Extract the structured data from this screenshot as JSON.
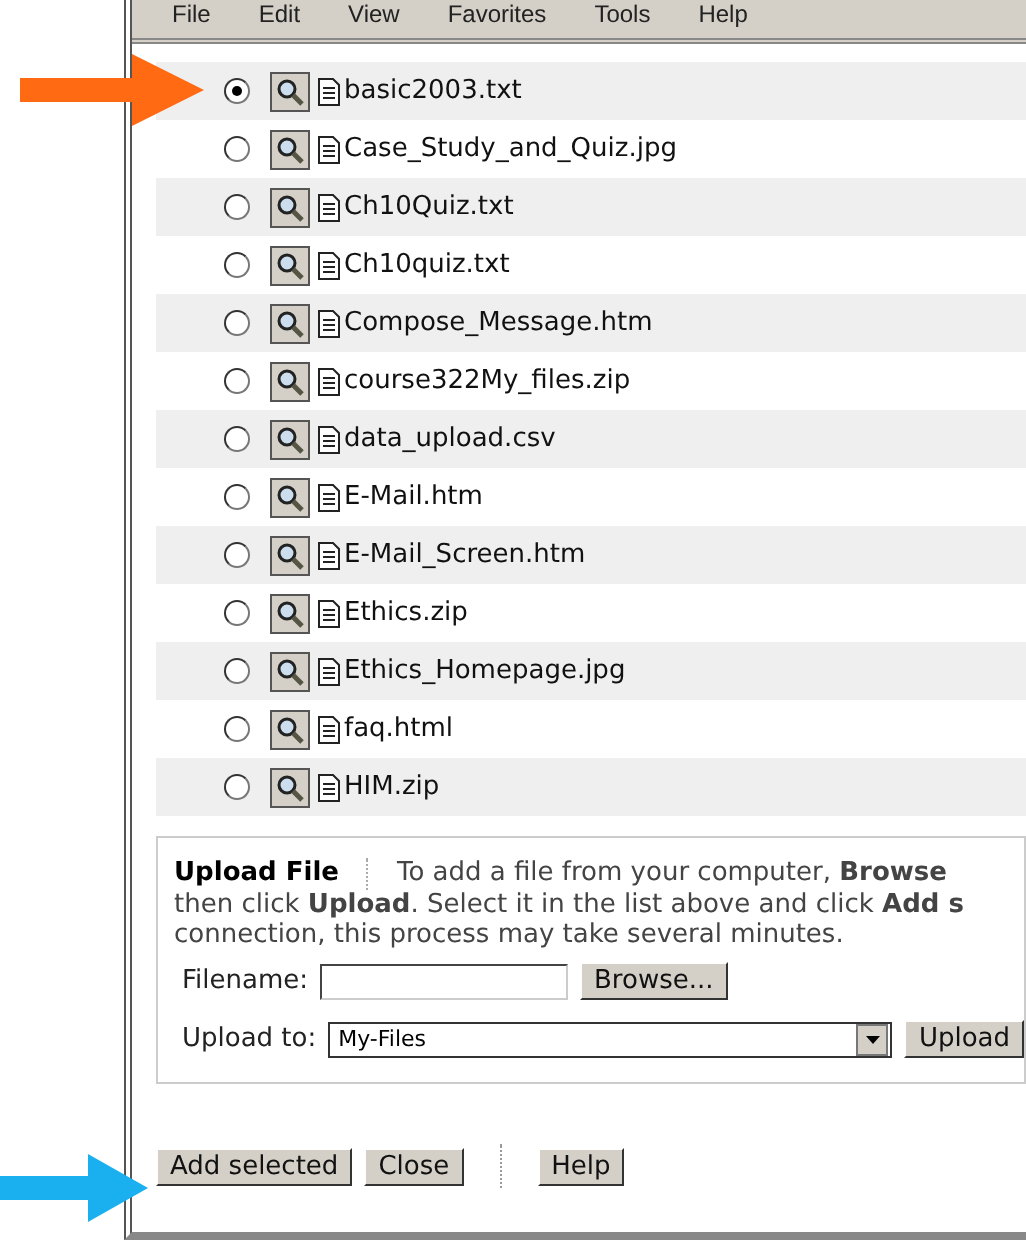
{
  "menu_bar": [
    "File",
    "Edit",
    "View",
    "Favorites",
    "Tools",
    "Help"
  ],
  "files": [
    {
      "name": "basic2003.txt",
      "selected": true
    },
    {
      "name": "Case_Study_and_Quiz.jpg",
      "selected": false
    },
    {
      "name": "Ch10Quiz.txt",
      "selected": false
    },
    {
      "name": "Ch10quiz.txt",
      "selected": false
    },
    {
      "name": "Compose_Message.htm",
      "selected": false
    },
    {
      "name": "course322My_files.zip",
      "selected": false
    },
    {
      "name": "data_upload.csv",
      "selected": false
    },
    {
      "name": "E-Mail.htm",
      "selected": false
    },
    {
      "name": "E-Mail_Screen.htm",
      "selected": false
    },
    {
      "name": "Ethics.zip",
      "selected": false
    },
    {
      "name": "Ethics_Homepage.jpg",
      "selected": false
    },
    {
      "name": "faq.html",
      "selected": false
    },
    {
      "name": "HIM.zip",
      "selected": false
    }
  ],
  "upload": {
    "title": "Upload File",
    "instructions": [
      "To add a file from your computer, **Browse**",
      "then click **Upload**. Select it in the list above and click **Add s**",
      "connection, this process may take several minutes."
    ],
    "filename_label": "Filename:",
    "browse_button": "Browse...",
    "upload_to_label": "Upload to:",
    "upload_to_value": "My-Files",
    "upload_button": "Upload"
  },
  "buttons": [
    "Add selected",
    "Close",
    "Help"
  ]
}
